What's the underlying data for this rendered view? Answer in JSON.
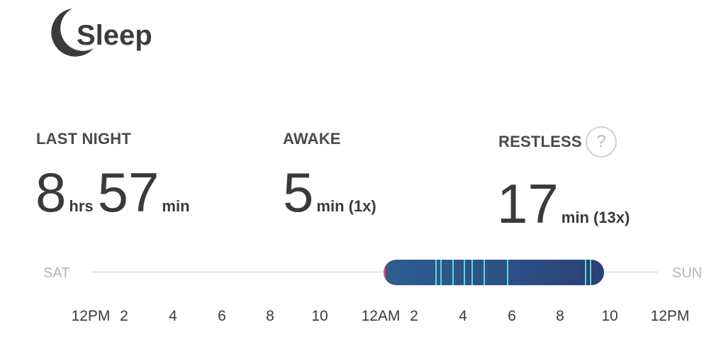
{
  "header": {
    "title": "Sleep",
    "icon": "moon-icon"
  },
  "stats": {
    "last_night": {
      "label": "LAST NIGHT",
      "hours": "8",
      "hours_unit": "hrs",
      "minutes": "57",
      "minutes_unit": "min"
    },
    "awake": {
      "label": "AWAKE",
      "value": "5",
      "unit": "min (1x)"
    },
    "restless": {
      "label": "RESTLESS",
      "value": "17",
      "unit": "min (13x)",
      "help": "?"
    }
  },
  "timeline": {
    "start_day": "SAT",
    "end_day": "SUN",
    "ticks": [
      "12PM",
      "2",
      "4",
      "6",
      "8",
      "10",
      "12AM",
      "2",
      "4",
      "6",
      "8",
      "10",
      "12PM"
    ],
    "bar_color": "#2c4f86",
    "restless_color": "#5fd7dc",
    "awake_color": "#e0457a"
  }
}
